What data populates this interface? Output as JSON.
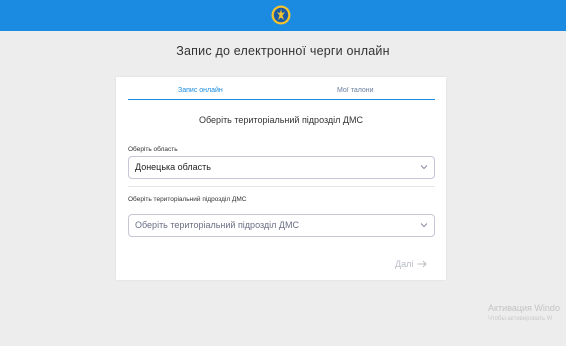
{
  "header": {
    "emblem_icon": "coat-of-arms-icon",
    "background_color": "#1a8be0"
  },
  "page": {
    "title": "Запис до електронної черги онлайн"
  },
  "tabs": [
    {
      "label": "Запис онлайн",
      "active": true
    },
    {
      "label": "Мої талони",
      "active": false
    }
  ],
  "form": {
    "heading": "Оберіть територіальний підрозділ ДМС",
    "region": {
      "label": "Оберіть область",
      "value": "Донецька область"
    },
    "unit": {
      "label": "Оберіть територіальний підрозділ ДМС",
      "placeholder": "Оберіть територіальний підрозділ ДМС"
    },
    "next_label": "Далі"
  },
  "watermark": {
    "title": "Активация Windo",
    "subtitle": "Чтобы активировать W"
  },
  "colors": {
    "accent": "#1a8be0",
    "background": "#ededed",
    "disabled": "#b9bcc6"
  }
}
